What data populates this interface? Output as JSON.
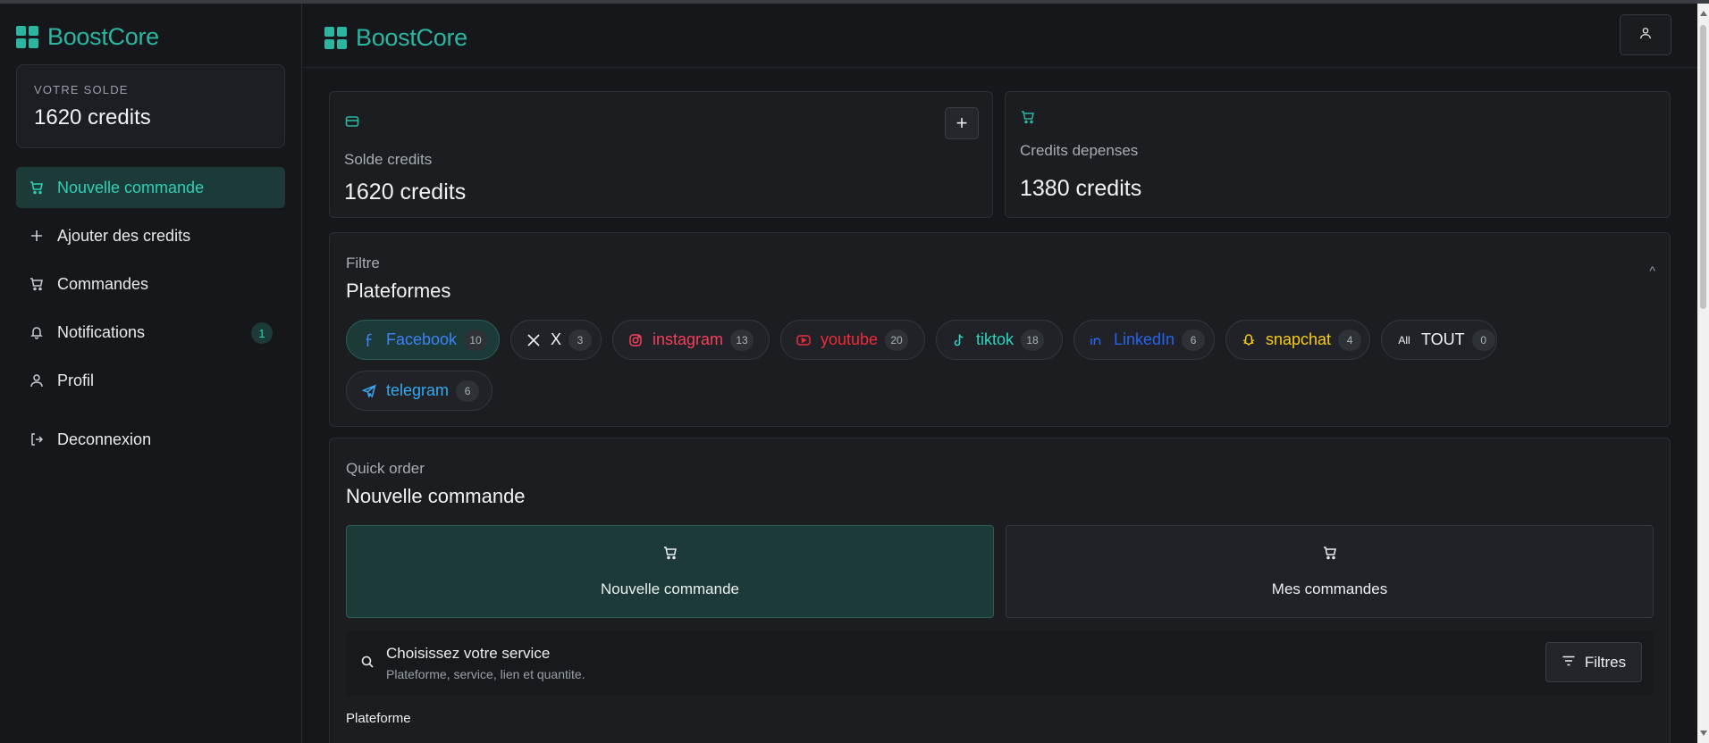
{
  "app": {
    "brand": "BoostCore"
  },
  "sidebar": {
    "balance_label": "VOTRE SOLDE",
    "balance_value": "1620 credits",
    "items": [
      {
        "label": "Nouvelle commande",
        "icon": "cart-icon",
        "active": true
      },
      {
        "label": "Ajouter des credits",
        "icon": "plus-icon"
      },
      {
        "label": "Commandes",
        "icon": "cart-icon"
      },
      {
        "label": "Notifications",
        "icon": "bell-icon",
        "badge": "1"
      },
      {
        "label": "Profil",
        "icon": "user-icon"
      }
    ],
    "logout": "Deconnexion"
  },
  "stats": {
    "balance": {
      "label": "Solde credits",
      "value": "1620 credits",
      "icon": "wallet-icon"
    },
    "spent": {
      "label": "Credits depenses",
      "value": "1380 credits",
      "icon": "cart-icon"
    }
  },
  "filter": {
    "subtitle": "Filtre",
    "title": "Plateformes",
    "platforms": [
      {
        "name": "Facebook",
        "count": "10",
        "color": "#3b82f6",
        "icon": "facebook-icon",
        "selected": true
      },
      {
        "name": "X",
        "count": "3",
        "color": "#f2f3f5",
        "icon": "x-icon"
      },
      {
        "name": "instagram",
        "count": "13",
        "color": "#f43f5e",
        "icon": "instagram-icon"
      },
      {
        "name": "youtube",
        "count": "20",
        "color": "#ef2b3a",
        "icon": "youtube-icon"
      },
      {
        "name": "tiktok",
        "count": "18",
        "color": "#2dd4bf",
        "icon": "tiktok-icon"
      },
      {
        "name": "LinkedIn",
        "count": "6",
        "color": "#2563eb",
        "icon": "linkedin-icon"
      },
      {
        "name": "snapchat",
        "count": "4",
        "color": "#facc15",
        "icon": "snapchat-icon"
      },
      {
        "name": "TOUT",
        "count": "0",
        "color": "#f2f3f5",
        "icon": "all-icon",
        "icon_text": "All"
      },
      {
        "name": "telegram",
        "count": "6",
        "color": "#38a8f0",
        "icon": "telegram-icon"
      }
    ]
  },
  "order": {
    "subtitle": "Quick order",
    "title": "Nouvelle commande",
    "tab_new": "Nouvelle commande",
    "tab_mine": "Mes commandes",
    "search_title": "Choisissez votre service",
    "search_sub": "Plateforme, service, lien et quantite.",
    "filters_btn": "Filtres",
    "platform_label": "Plateforme"
  },
  "colors": {
    "accent": "#2cb5a0",
    "active_bg": "#1c3a37",
    "bg": "#15171b",
    "card": "#1b1d21"
  }
}
